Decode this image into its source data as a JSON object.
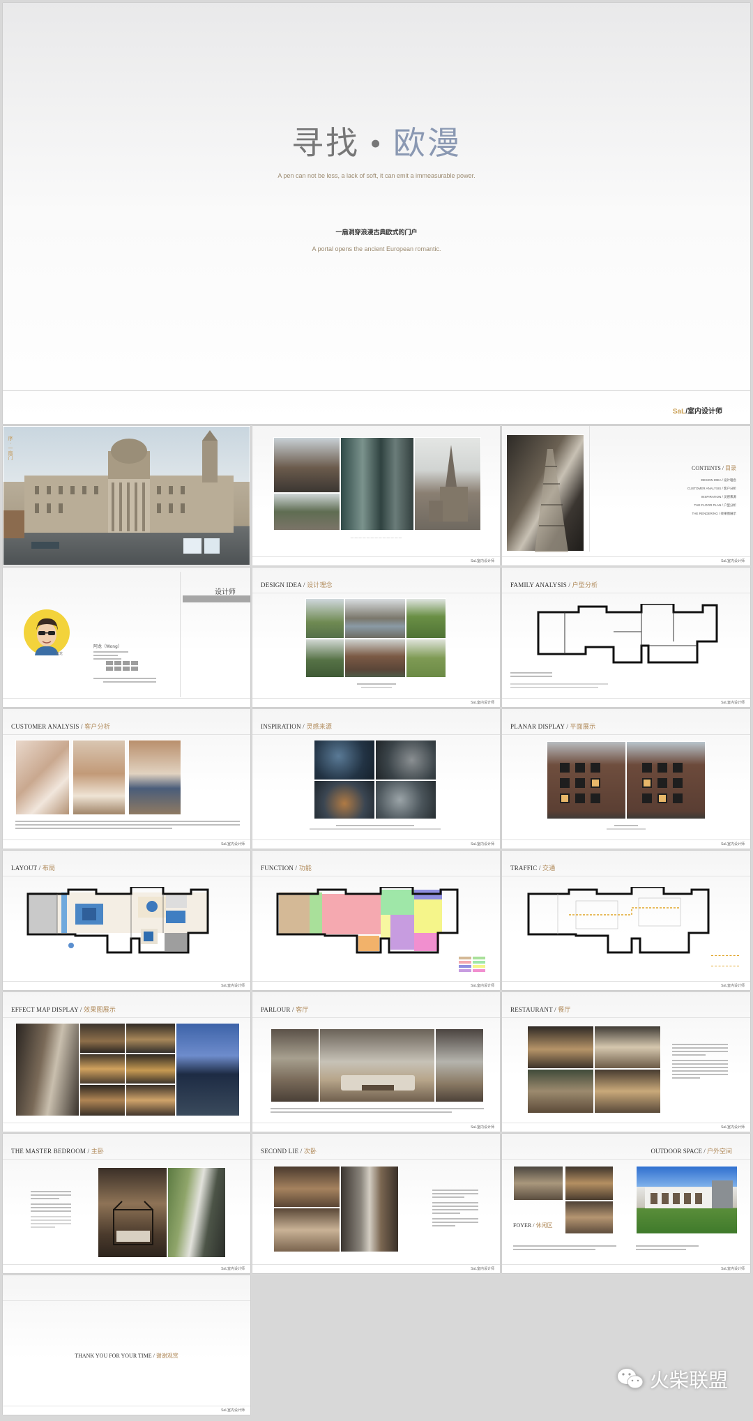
{
  "cover": {
    "title_a": "寻找",
    "title_dot": "•",
    "title_b": "欧漫",
    "subtitle_en": "A pen can not be less, a lack of soft, it can emit a immeasurable power.",
    "tagline_cn": "一扇洞穿浪漫古典欧式的门户",
    "tagline_en": "A portal opens the ancient European romantic.",
    "brand_prefix": "SaL",
    "brand_name": "/室内设计师"
  },
  "footer_brand": "SaL室内设计师",
  "slides": {
    "preface": {
      "label": "序 · 一扇门"
    },
    "contents": {
      "title_en": "CONTENTS /",
      "title_cn": "目录",
      "items": [
        "DESIGN IDEA / 设计理念",
        "CUSTOMER ANALYSIS / 客户分析",
        "INSPIRATION / 灵感来源",
        "THE FLOOR PLAN / 户型分析",
        "THE RENDERING / 效果图展示"
      ]
    },
    "designer": {
      "title_cn": "设计师",
      "name": "阿龙（Wong）",
      "avatar_label": "阿龙"
    },
    "design_idea": {
      "title_en": "DESIGN IDEA /",
      "title_cn": "设计理念"
    },
    "family_analysis": {
      "title_en": "FAMILY ANALYSIS /",
      "title_cn": "户型分析"
    },
    "customer_analysis": {
      "title_en": "CUSTOMER ANALYSIS /",
      "title_cn": "客户分析"
    },
    "inspiration": {
      "title_en": "INSPIRATION /",
      "title_cn": "灵感来源"
    },
    "planar_display": {
      "title_en": "PLANAR DISPLAY /",
      "title_cn": "平面展示"
    },
    "layout": {
      "title_en": "LAYOUT /",
      "title_cn": "布局"
    },
    "function": {
      "title_en": "FUNCTION /",
      "title_cn": "功能"
    },
    "traffic": {
      "title_en": "TRAFFIC /",
      "title_cn": "交通"
    },
    "effect_map": {
      "title_en": "EFFECT MAP DISPLAY /",
      "title_cn": "效果图展示"
    },
    "parlour": {
      "title_en": "PARLOUR /",
      "title_cn": "客厅"
    },
    "restaurant": {
      "title_en": "RESTAURANT /",
      "title_cn": "餐厅"
    },
    "master_bedroom": {
      "title_en": "THE MASTER BEDROOM /",
      "title_cn": "主卧"
    },
    "second_lie": {
      "title_en": "SECOND LIE /",
      "title_cn": "次卧"
    },
    "outdoor": {
      "title_en": "OUTDOOR SPACE /",
      "title_cn": "户外空间",
      "foyer_en": "FOYER /",
      "foyer_cn": "休闲区"
    },
    "thanks": {
      "title_en": "THANK YOU FOR YOUR TIME /",
      "title_cn": "谢谢观赏"
    }
  },
  "watermark": "火柴联盟",
  "colors": {
    "accent_gold": "#b08a5a",
    "title_blue": "#8a98b2",
    "background": "#d8d8d8"
  }
}
